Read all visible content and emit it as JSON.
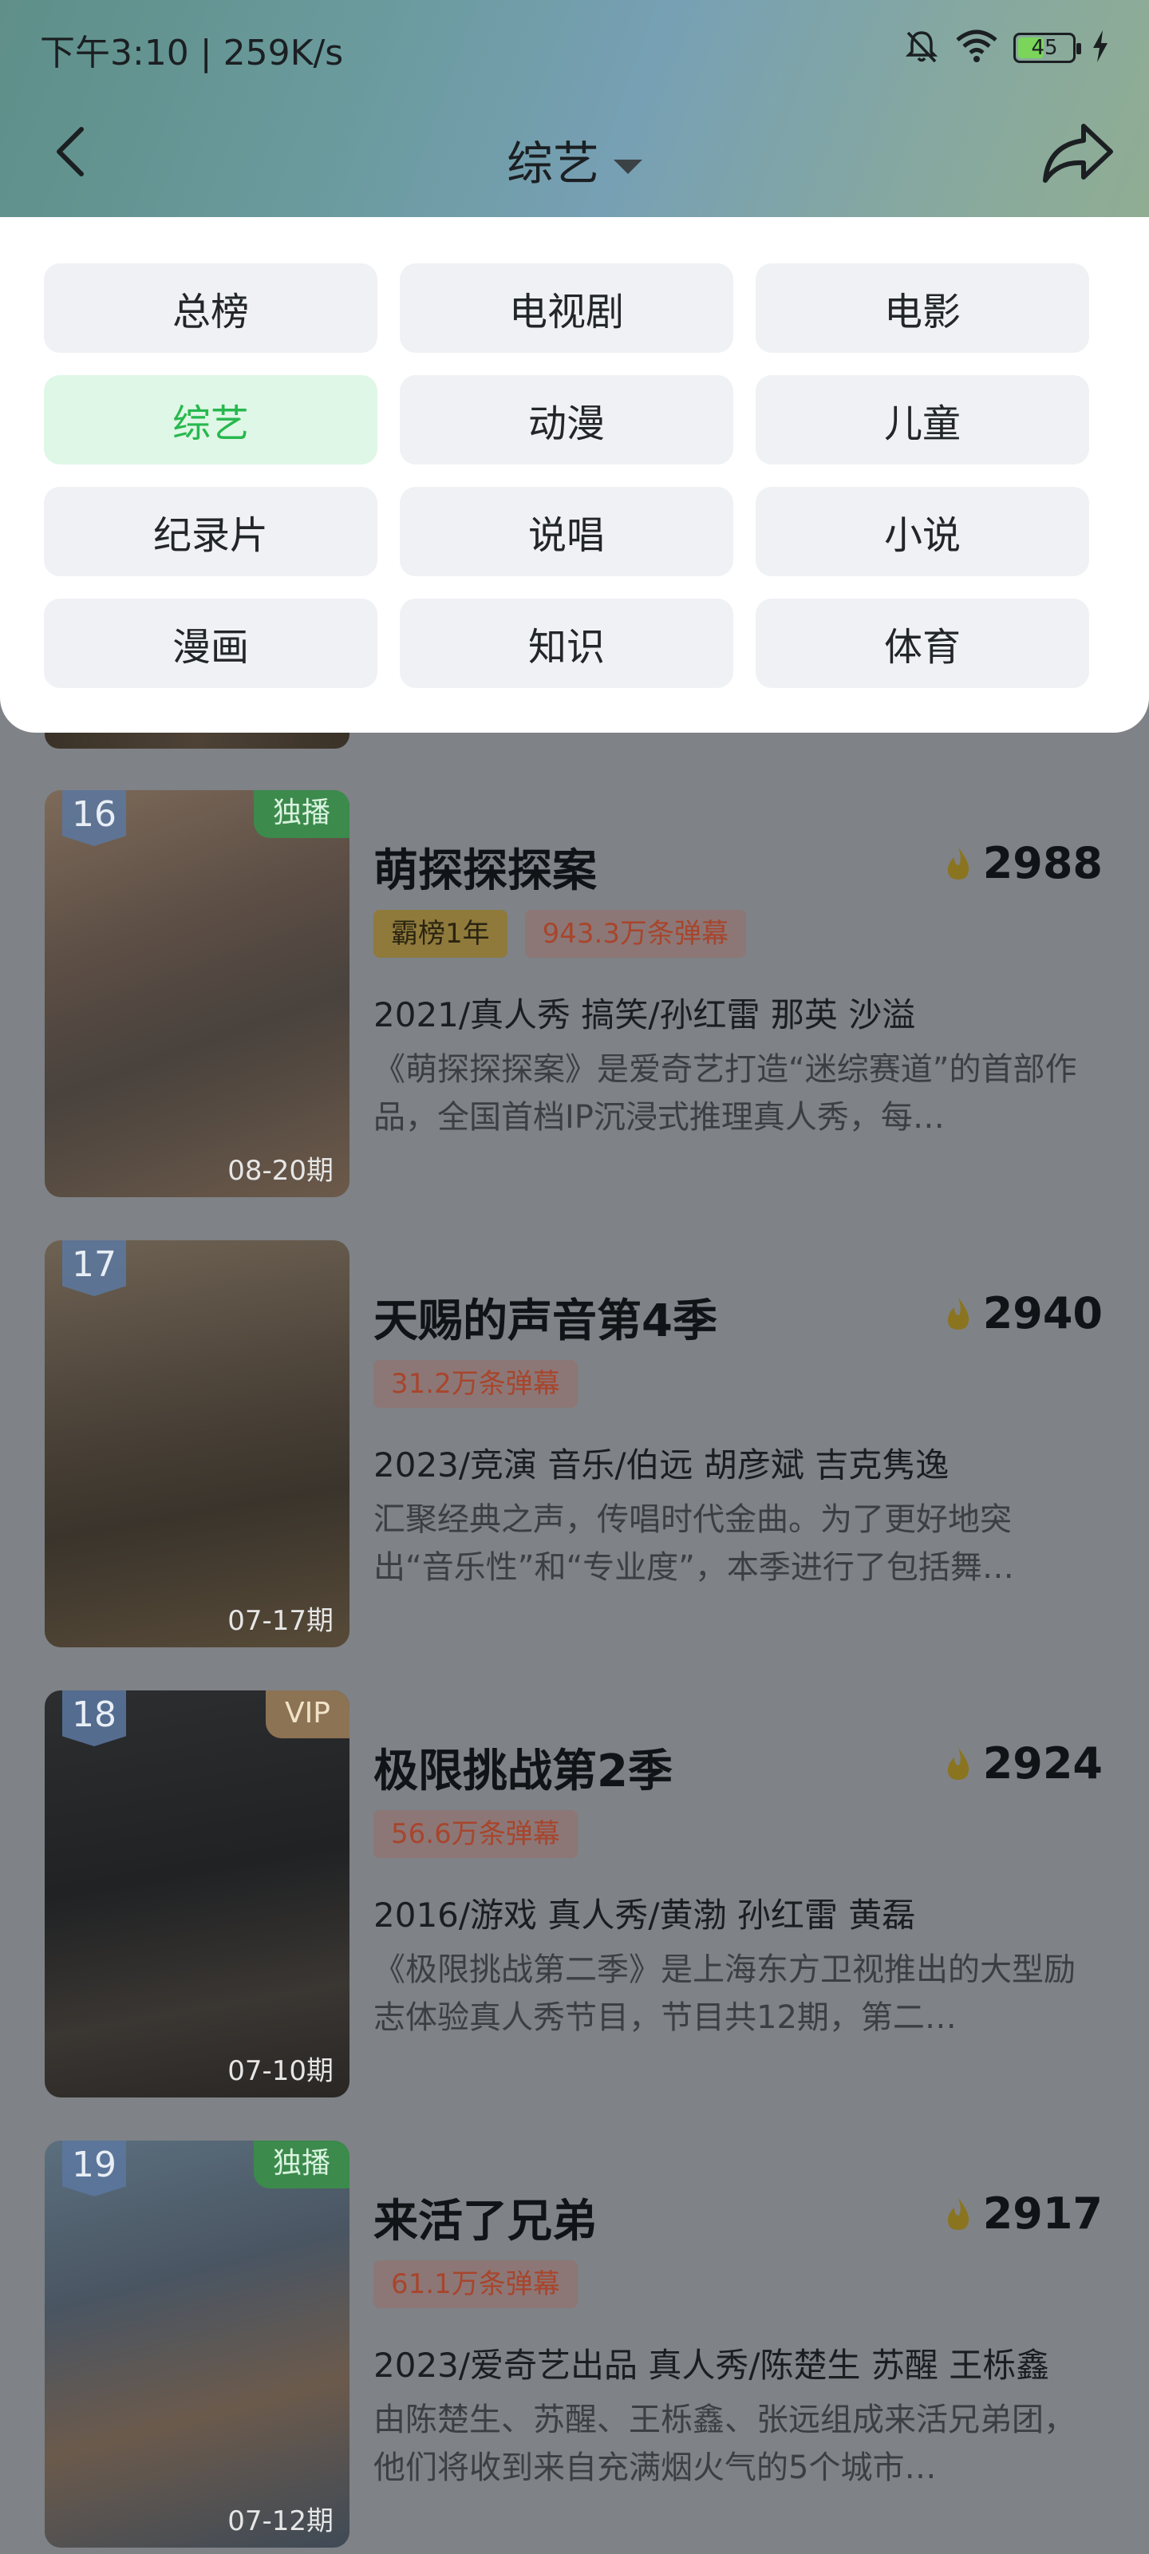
{
  "status_bar": {
    "time_speed": "下午3:10 | 259K/s",
    "battery": "45"
  },
  "nav": {
    "title": "综艺"
  },
  "categories": [
    {
      "label": "总榜",
      "selected": false
    },
    {
      "label": "电视剧",
      "selected": false
    },
    {
      "label": "电影",
      "selected": false
    },
    {
      "label": "综艺",
      "selected": true
    },
    {
      "label": "动漫",
      "selected": false
    },
    {
      "label": "儿童",
      "selected": false
    },
    {
      "label": "纪录片",
      "selected": false
    },
    {
      "label": "说唱",
      "selected": false
    },
    {
      "label": "小说",
      "selected": false
    },
    {
      "label": "漫画",
      "selected": false
    },
    {
      "label": "知识",
      "selected": false
    },
    {
      "label": "体育",
      "selected": false
    }
  ],
  "items": [
    {
      "rank": "16",
      "tag": "独播",
      "episode": "08-20期",
      "title": "萌探探探案",
      "heat": "2988",
      "badge_gold": "霸榜1年",
      "badge_danmu": "943.3万条弹幕",
      "meta": "2021/真人秀 搞笑/孙红雷 那英 沙溢",
      "desc": "《萌探探探案》是爱奇艺打造“迷综赛道”的首部作品，全国首档IP沉浸式推理真人秀，每…"
    },
    {
      "rank": "17",
      "tag": "",
      "episode": "07-17期",
      "title": "天赐的声音第4季",
      "heat": "2940",
      "badge_gold": "",
      "badge_danmu": "31.2万条弹幕",
      "meta": "2023/竞演 音乐/伯远 胡彦斌 吉克隽逸",
      "desc": "汇聚经典之声，传唱时代金曲。为了更好地突出“音乐性”和“专业度”，本季进行了包括舞…"
    },
    {
      "rank": "18",
      "tag": "VIP",
      "episode": "07-10期",
      "title": "极限挑战第2季",
      "heat": "2924",
      "badge_gold": "",
      "badge_danmu": "56.6万条弹幕",
      "meta": "2016/游戏 真人秀/黄渤 孙红雷 黄磊",
      "desc": "《极限挑战第二季》是上海东方卫视推出的大型励志体验真人秀节目，节目共12期，第二…"
    },
    {
      "rank": "19",
      "tag": "独播",
      "episode": "07-12期",
      "title": "来活了兄弟",
      "heat": "2917",
      "badge_gold": "",
      "badge_danmu": "61.1万条弹幕",
      "meta": "2023/爱奇艺出品 真人秀/陈楚生 苏醒 王栎鑫",
      "desc": "由陈楚生、苏醒、王栎鑫、张远组成来活兄弟团，他们将收到来自充满烟火气的5个城市…"
    }
  ]
}
